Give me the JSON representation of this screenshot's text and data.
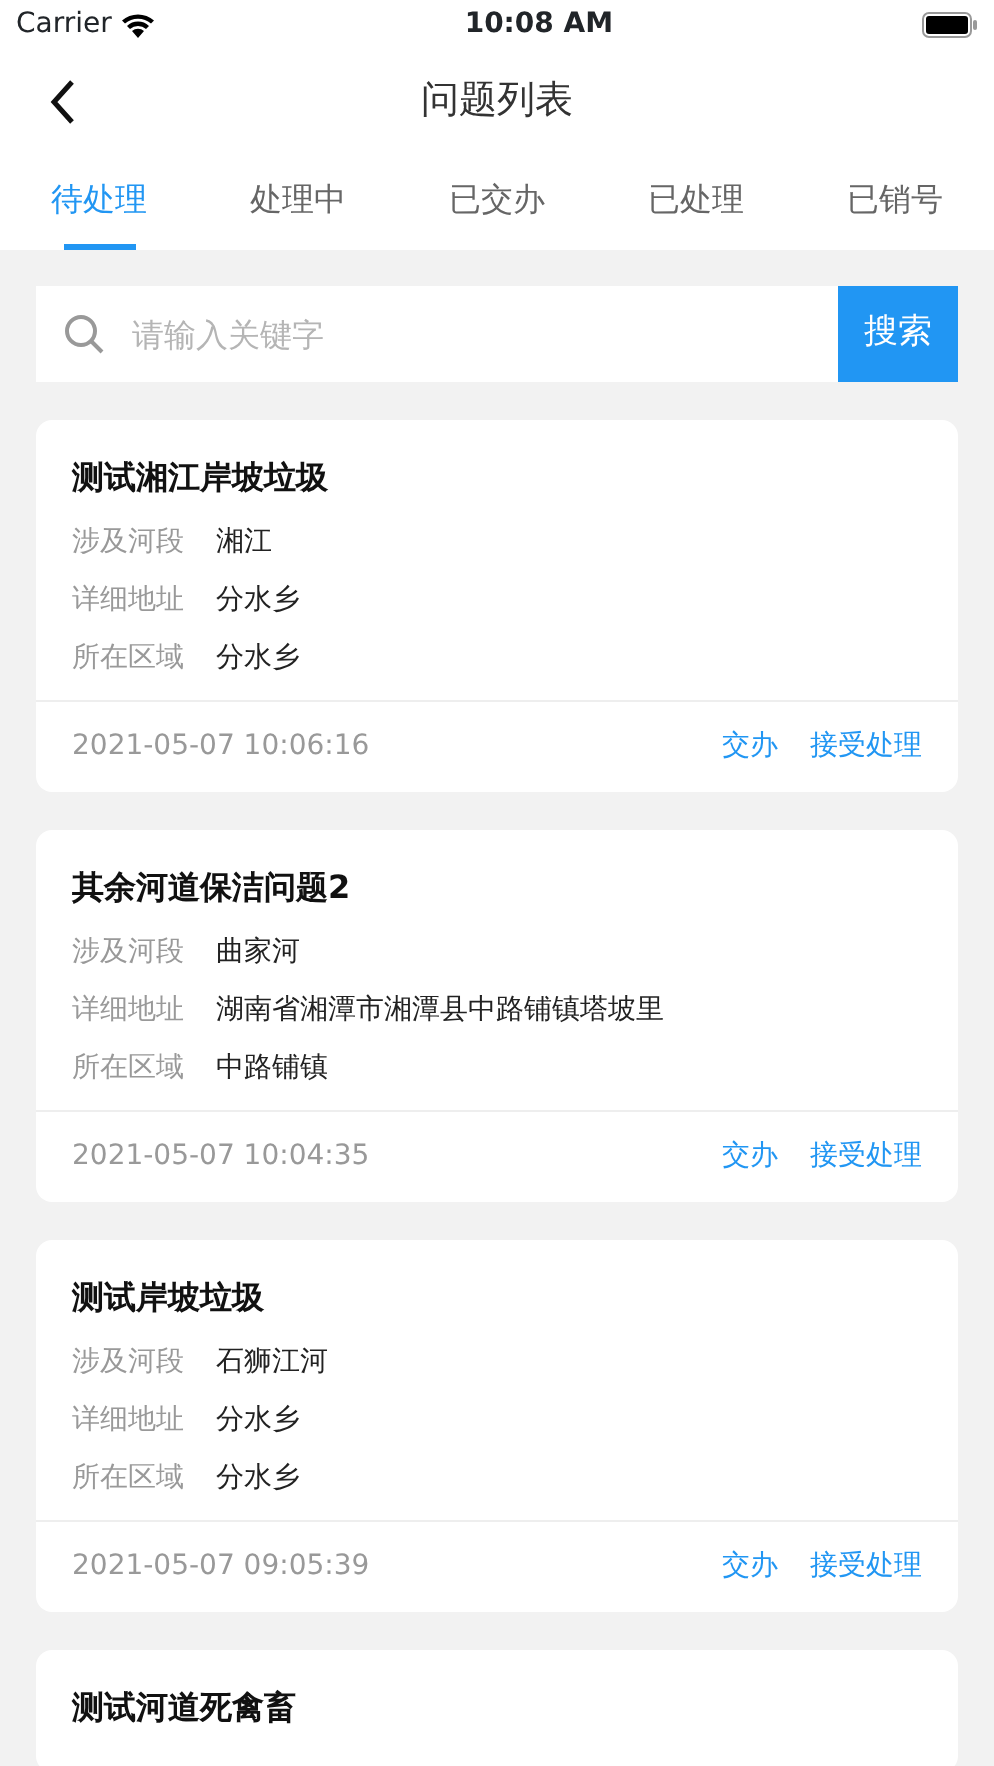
{
  "status_bar": {
    "carrier": "Carrier",
    "time": "10:08 AM"
  },
  "nav": {
    "title": "问题列表"
  },
  "tabs": [
    {
      "label": "待处理",
      "selected": true
    },
    {
      "label": "处理中",
      "selected": false
    },
    {
      "label": "已交办",
      "selected": false
    },
    {
      "label": "已处理",
      "selected": false
    },
    {
      "label": "已销号",
      "selected": false
    }
  ],
  "search": {
    "placeholder": "请输入关键字",
    "button": "搜索"
  },
  "issues": [
    {
      "title": "测试湘江岸坡垃圾",
      "fields": [
        {
          "label": "涉及河段",
          "value": "湘江"
        },
        {
          "label": "详细地址",
          "value": "分水乡"
        },
        {
          "label": "所在区域",
          "value": "分水乡"
        }
      ],
      "time": "2021-05-07 10:06:16",
      "actions": [
        "交办",
        "接受处理"
      ]
    },
    {
      "title": "其余河道保洁问题2",
      "fields": [
        {
          "label": "涉及河段",
          "value": "曲家河"
        },
        {
          "label": "详细地址",
          "value": "湖南省湘潭市湘潭县中路铺镇塔坡里"
        },
        {
          "label": "所在区域",
          "value": "中路铺镇"
        }
      ],
      "time": "2021-05-07 10:04:35",
      "actions": [
        "交办",
        "接受处理"
      ]
    },
    {
      "title": "测试岸坡垃圾",
      "fields": [
        {
          "label": "涉及河段",
          "value": "石狮江河"
        },
        {
          "label": "详细地址",
          "value": "分水乡"
        },
        {
          "label": "所在区域",
          "value": "分水乡"
        }
      ],
      "time": "2021-05-07 09:05:39",
      "actions": [
        "交办",
        "接受处理"
      ]
    },
    {
      "title": "测试河道死禽畜"
    }
  ]
}
